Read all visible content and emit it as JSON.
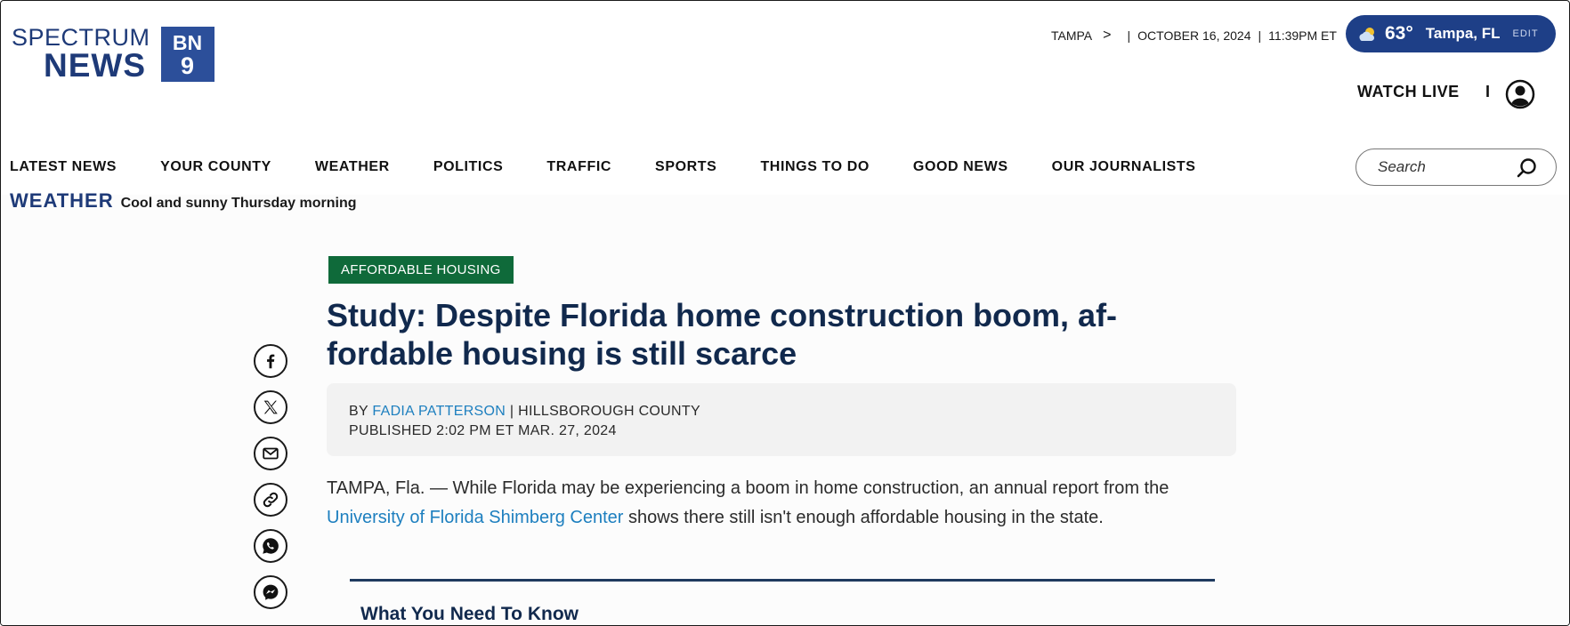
{
  "logo": {
    "line1": "SPECTRUM",
    "line2": "NEWS",
    "badge_top": "BN",
    "badge_bottom": "9"
  },
  "header": {
    "location": "TAMPA",
    "location_chevron": ">",
    "date": "OCTOBER 16, 2024",
    "time": "11:39PM ET",
    "weather": {
      "temp": "63°",
      "city": "Tampa, FL",
      "edit_label": "EDIT",
      "icon": "partly-cloudy-icon"
    },
    "watch_live": "WATCH LIVE",
    "watch_sep": "I"
  },
  "nav": {
    "items": [
      "LATEST NEWS",
      "YOUR COUNTY",
      "WEATHER",
      "POLITICS",
      "TRAFFIC",
      "SPORTS",
      "THINGS TO DO",
      "GOOD NEWS",
      "OUR JOURNALISTS"
    ],
    "search_placeholder": "Search"
  },
  "ticker": {
    "label": "WEATHER",
    "message": "Cool and sunny Thursday morning"
  },
  "article": {
    "category": "AFFORDABLE HOUSING",
    "headline_line1": "Study: Despite Florida home construction boom, af-",
    "headline_line2": "fordable housing is still scarce",
    "by": "BY",
    "author": "FADIA PATTERSON",
    "author_sep": "|",
    "county": "HILLSBOROUGH COUNTY",
    "published": "PUBLISHED 2:02 PM ET MAR. 27, 2024",
    "lede_part1": "TAMPA, Fla. — While Florida may be experiencing a boom in home construction, an annual report from the ",
    "lede_link": "University of Florida Shimberg Center",
    "lede_part2": " shows there still isn't enough affordable housing in the state.",
    "section_heading": "What You Need To Know"
  },
  "share": [
    "facebook-icon",
    "x-icon",
    "email-icon",
    "link-icon",
    "whatsapp-icon",
    "messenger-icon"
  ],
  "colors": {
    "brand_blue": "#1e3a78",
    "category_green": "#0f6a3a",
    "link_blue": "#1d7fbf",
    "headline": "#11294d"
  }
}
